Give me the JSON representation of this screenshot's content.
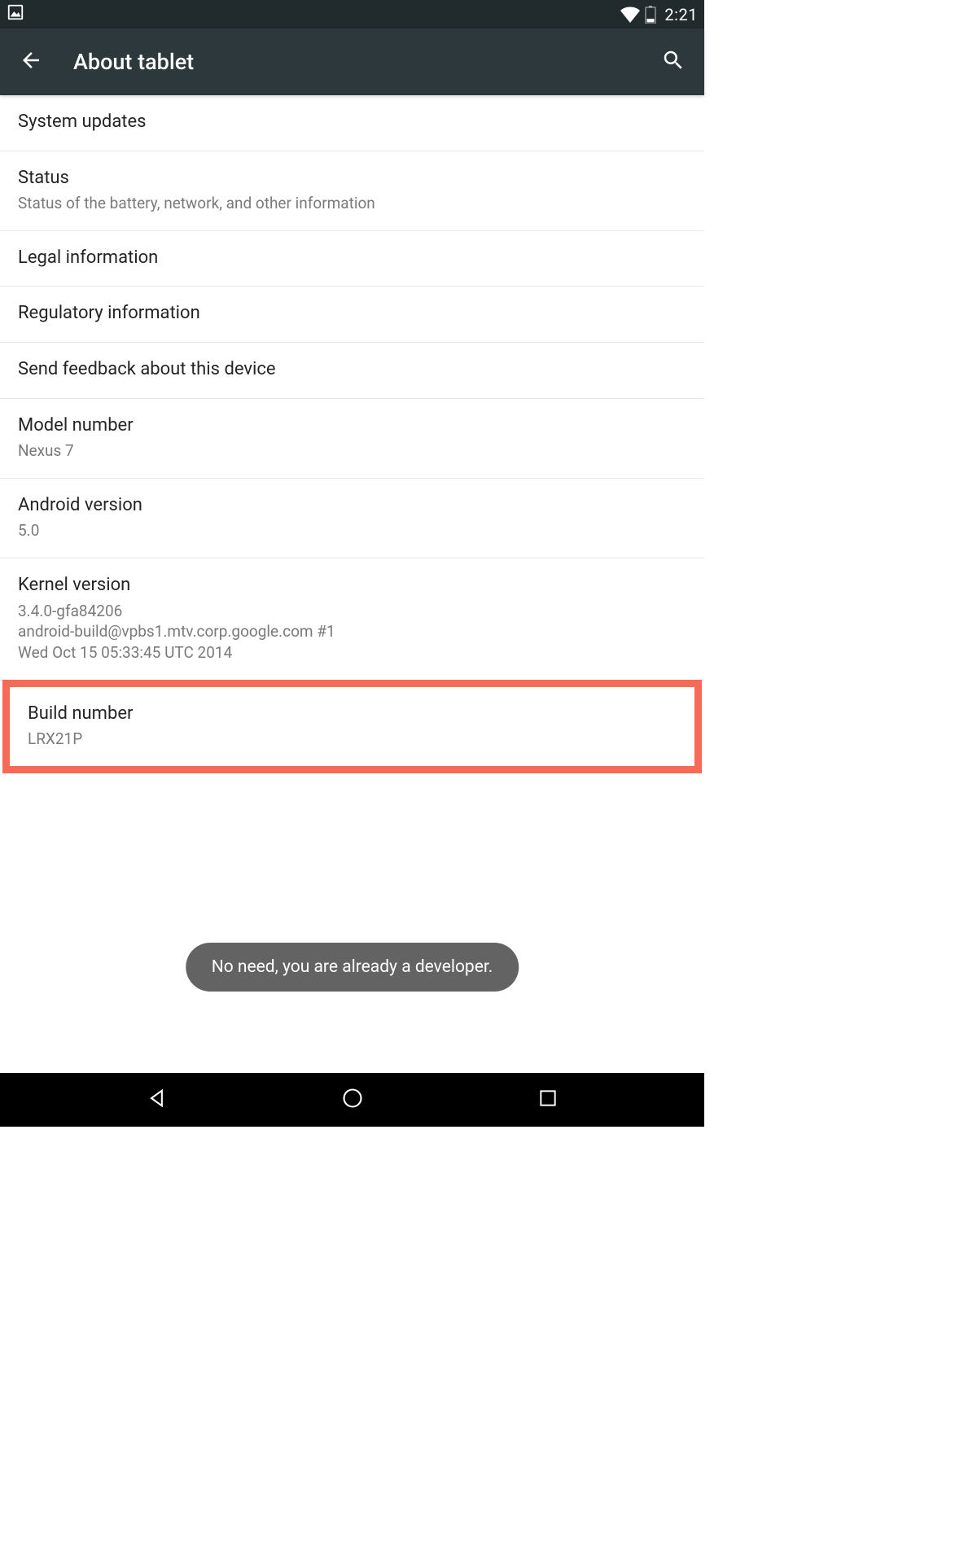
{
  "status_bar": {
    "clock": "2:21",
    "icons": {
      "image": "image-icon",
      "wifi": "wifi-icon",
      "battery": "battery-icon"
    }
  },
  "app_bar": {
    "title": "About tablet",
    "back_icon": "arrow-back-icon",
    "search_icon": "search-icon"
  },
  "items": [
    {
      "title": "System updates",
      "sub": ""
    },
    {
      "title": "Status",
      "sub": "Status of the battery, network, and other information"
    },
    {
      "title": "Legal information",
      "sub": ""
    },
    {
      "title": "Regulatory information",
      "sub": ""
    },
    {
      "title": "Send feedback about this device",
      "sub": ""
    },
    {
      "title": "Model number",
      "sub": "Nexus 7"
    },
    {
      "title": "Android version",
      "sub": "5.0"
    },
    {
      "title": "Kernel version",
      "sub": "3.4.0-gfa84206\nandroid-build@vpbs1.mtv.corp.google.com #1\nWed Oct 15 05:33:45 UTC 2014"
    },
    {
      "title": "Build number",
      "sub": "LRX21P",
      "highlight": true
    }
  ],
  "toast": {
    "text": "No need, you are already a developer."
  },
  "nav_bar": {
    "back": "nav-back-icon",
    "home": "nav-home-icon",
    "recent": "nav-recent-icon"
  },
  "colors": {
    "status_bg": "#212b2e",
    "appbar_bg": "#2c383c",
    "highlight": "#f76b56",
    "toast_bg": "#636363",
    "divider": "#e6e6e6",
    "text_primary": "#252525",
    "text_secondary": "#7a7a7a"
  }
}
